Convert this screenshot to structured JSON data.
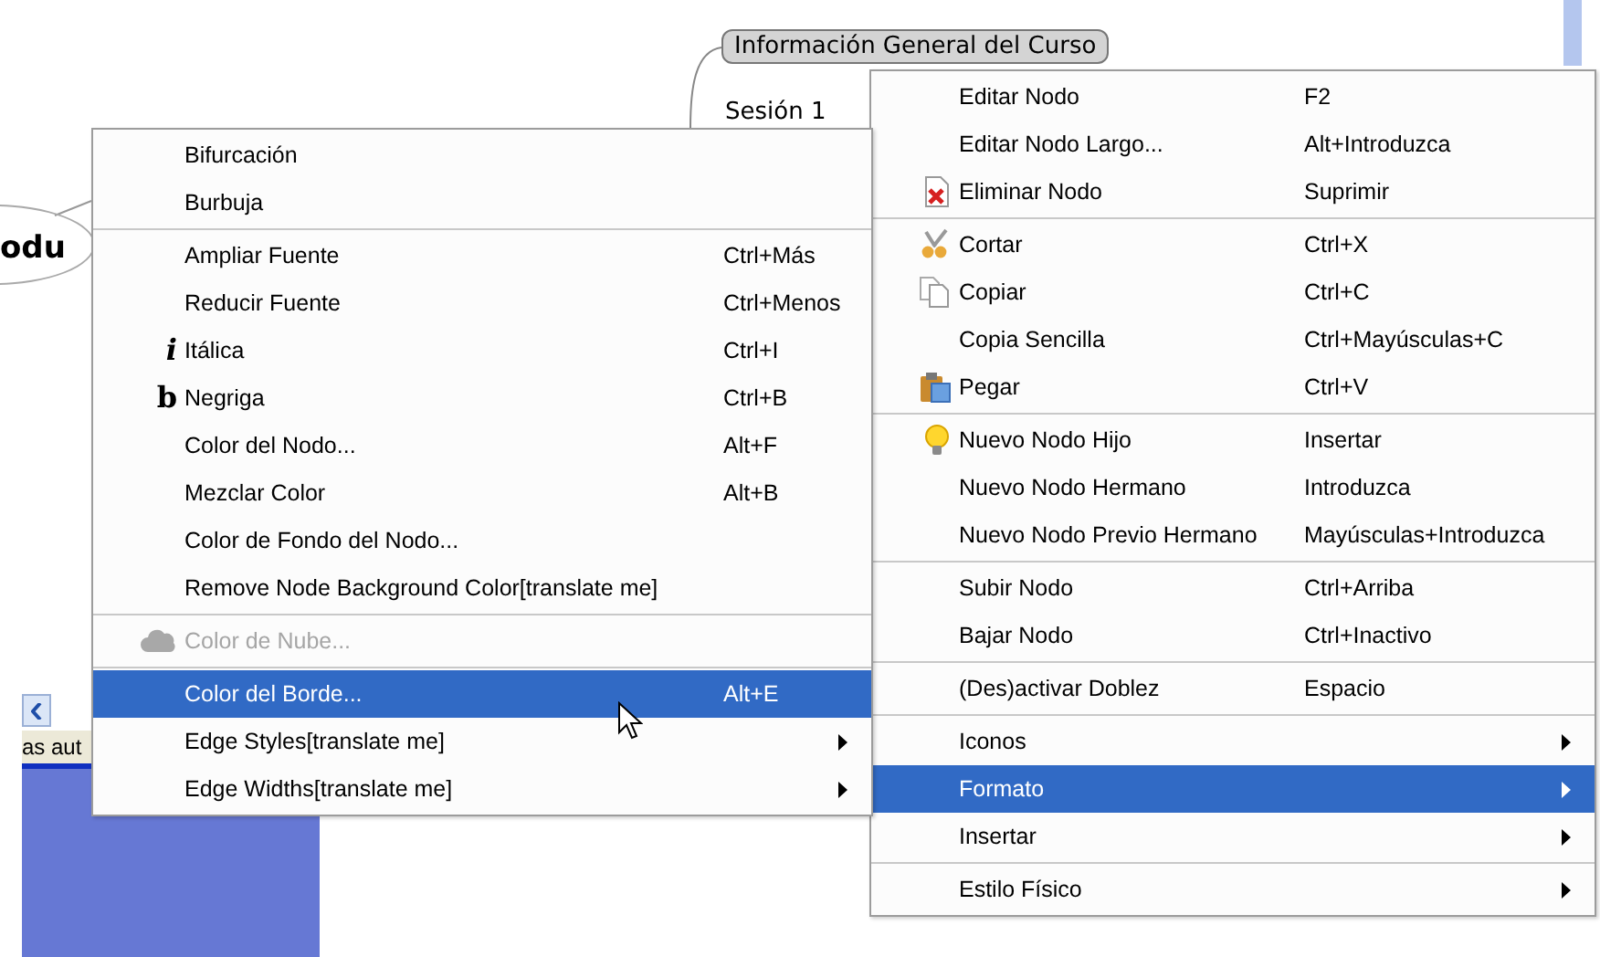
{
  "mind_map": {
    "nodes": [
      {
        "text": "Información General del Curso",
        "kind": "bubble"
      },
      {
        "text": "Sesión 1",
        "kind": "fork"
      },
      {
        "text": "odu",
        "kind": "root"
      }
    ]
  },
  "side_panel": {
    "status_text": "as aut"
  },
  "node_menu": {
    "sections": [
      [
        {
          "label": "Editar Nodo",
          "shortcut": "F2",
          "kind": "command",
          "selected": false,
          "disabled": false
        },
        {
          "label": "Editar Nodo Largo...",
          "shortcut": "Alt+Introduzca",
          "kind": "command",
          "selected": false,
          "disabled": false
        },
        {
          "label": "Eliminar Nodo",
          "shortcut": "Suprimir",
          "kind": "command",
          "selected": false,
          "disabled": false
        }
      ],
      [
        {
          "label": "Cortar",
          "shortcut": "Ctrl+X",
          "kind": "command",
          "selected": false,
          "disabled": false
        },
        {
          "label": "Copiar",
          "shortcut": "Ctrl+C",
          "kind": "command",
          "selected": false,
          "disabled": false
        },
        {
          "label": "Copia Sencilla",
          "shortcut": "Ctrl+Mayúsculas+C",
          "kind": "command",
          "selected": false,
          "disabled": false
        },
        {
          "label": "Pegar",
          "shortcut": "Ctrl+V",
          "kind": "command",
          "selected": false,
          "disabled": false
        }
      ],
      [
        {
          "label": "Nuevo Nodo Hijo",
          "shortcut": "Insertar",
          "kind": "command",
          "selected": false,
          "disabled": false
        },
        {
          "label": "Nuevo Nodo Hermano",
          "shortcut": "Introduzca",
          "kind": "command",
          "selected": false,
          "disabled": false
        },
        {
          "label": "Nuevo Nodo Previo Hermano",
          "shortcut": "Mayúsculas+Introduzca",
          "kind": "command",
          "selected": false,
          "disabled": false
        }
      ],
      [
        {
          "label": "Subir Nodo",
          "shortcut": "Ctrl+Arriba",
          "kind": "command",
          "selected": false,
          "disabled": false
        },
        {
          "label": "Bajar Nodo",
          "shortcut": "Ctrl+Inactivo",
          "kind": "command",
          "selected": false,
          "disabled": false
        }
      ],
      [
        {
          "label": "(Des)activar Doblez",
          "shortcut": "Espacio",
          "kind": "command",
          "selected": false,
          "disabled": false
        }
      ],
      [
        {
          "label": "Iconos",
          "kind": "submenu",
          "selected": false,
          "disabled": false
        },
        {
          "label": "Formato",
          "kind": "submenu",
          "selected": true,
          "disabled": false
        },
        {
          "label": "Insertar",
          "kind": "submenu",
          "selected": false,
          "disabled": false
        }
      ],
      [
        {
          "label": "Estilo Físico",
          "kind": "submenu",
          "selected": false,
          "disabled": false
        }
      ]
    ]
  },
  "format_submenu": {
    "sections": [
      [
        {
          "label": "Bifurcación",
          "kind": "command",
          "selected": false,
          "disabled": false
        },
        {
          "label": "Burbuja",
          "kind": "command",
          "selected": false,
          "disabled": false
        }
      ],
      [
        {
          "label": "Ampliar Fuente",
          "shortcut": "Ctrl+Más",
          "kind": "command",
          "selected": false,
          "disabled": false
        },
        {
          "label": "Reducir Fuente",
          "shortcut": "Ctrl+Menos",
          "kind": "command",
          "selected": false,
          "disabled": false
        },
        {
          "label": "Itálica",
          "shortcut": "Ctrl+I",
          "kind": "command",
          "glyph": "i",
          "selected": false,
          "disabled": false
        },
        {
          "label": "Negriga",
          "shortcut": "Ctrl+B",
          "kind": "command",
          "glyph": "b",
          "selected": false,
          "disabled": false
        },
        {
          "label": "Color del Nodo...",
          "shortcut": "Alt+F",
          "kind": "command",
          "selected": false,
          "disabled": false
        },
        {
          "label": "Mezclar Color",
          "shortcut": "Alt+B",
          "kind": "command",
          "selected": false,
          "disabled": false
        },
        {
          "label": "Color de Fondo del Nodo...",
          "kind": "command",
          "selected": false,
          "disabled": false
        },
        {
          "label": "Remove Node Background Color[translate me]",
          "kind": "command",
          "selected": false,
          "disabled": false
        }
      ],
      [
        {
          "label": "Color de Nube...",
          "kind": "command",
          "selected": false,
          "disabled": true
        }
      ],
      [
        {
          "label": "Color del Borde...",
          "shortcut": "Alt+E",
          "kind": "command",
          "selected": true,
          "disabled": false
        },
        {
          "label": "Edge Styles[translate me]",
          "kind": "submenu",
          "selected": false,
          "disabled": false
        },
        {
          "label": "Edge Widths[translate me]",
          "kind": "submenu",
          "selected": false,
          "disabled": false
        }
      ]
    ]
  }
}
